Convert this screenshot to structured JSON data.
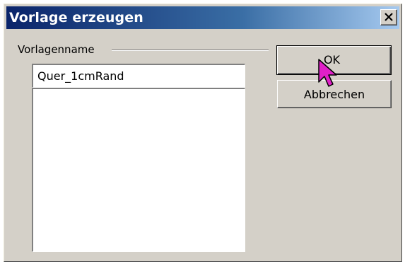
{
  "dialog": {
    "title": "Vorlage erzeugen",
    "close_icon": "close-icon"
  },
  "group": {
    "label": "Vorlagenname"
  },
  "name_input": {
    "value": "Quer_1cmRand"
  },
  "buttons": {
    "ok_label": "OK",
    "cancel_label": "Abbrechen"
  },
  "cursor": {
    "icon": "arrow-cursor-icon",
    "color": "#e020c8"
  },
  "colors": {
    "titlebar_start": "#0a246a",
    "titlebar_end": "#a6caf0",
    "face": "#d4d0c8"
  }
}
